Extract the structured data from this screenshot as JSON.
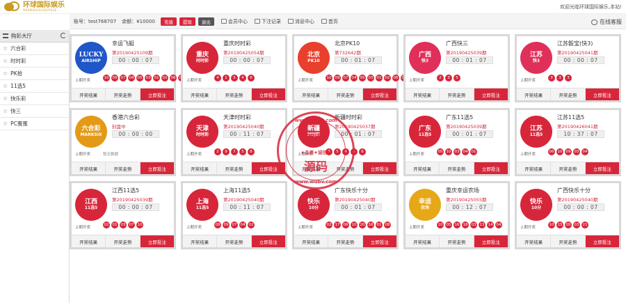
{
  "header": {
    "logo_cn": "环球国际娱乐",
    "logo_en": "HUANQIUGUOJIYULE",
    "welcome": "欢迎光临环球国际娱乐,本站!"
  },
  "account": {
    "account_label": "账号：test768707",
    "balance_label": "余额：¥10000",
    "recharge": "充值",
    "withdraw": "提现",
    "logout": "退出",
    "member_center": "会员中心",
    "bet_records": "下注记录",
    "messages": "消息中心",
    "home": "首页",
    "customer_service": "在线客服"
  },
  "sidebar": {
    "header": "购彩大厅",
    "items": [
      {
        "label": "六合彩"
      },
      {
        "label": "时时彩"
      },
      {
        "label": "PK拾"
      },
      {
        "label": "11选5"
      },
      {
        "label": "快乐彩"
      },
      {
        "label": "快三"
      },
      {
        "label": "PC蛋蛋"
      }
    ]
  },
  "card_labels": {
    "last_draw": "上期开奖",
    "results": "开奖结果",
    "trend": "开奖走势",
    "bet": "立即投注",
    "no_draw": "暂无数据"
  },
  "lotteries": [
    {
      "name": "幸运飞艇",
      "issue": "第20190425109期",
      "timer": "00 : 00 : 07",
      "balls": [
        "10",
        "09",
        "07",
        "04",
        "05",
        "03",
        "01",
        "02",
        "06",
        "08"
      ],
      "badge": {
        "l1": "LUCKY",
        "l2": "AIRSHIP",
        "color": "#1f57c8"
      }
    },
    {
      "name": "重庆时时彩",
      "issue": "第20190425054期",
      "timer": "00 : 00 : 07",
      "balls": [
        "4",
        "1",
        "5",
        "4",
        "6"
      ],
      "badge": {
        "l1": "重庆",
        "l2": "时时彩",
        "color": "#d7263a"
      }
    },
    {
      "name": "北京PK10",
      "issue": "第732642期",
      "timer": "00 : 01 : 07",
      "balls": [
        "10",
        "09",
        "07",
        "04",
        "05",
        "03",
        "01",
        "02",
        "06",
        "08"
      ],
      "badge": {
        "l1": "北京",
        "l2": "PK10",
        "color": "#e8402c"
      }
    },
    {
      "name": "广西快三",
      "issue": "第20190425039期",
      "timer": "00 : 01 : 07",
      "balls": [
        "2",
        "3",
        "5"
      ],
      "badge": {
        "l1": "广西",
        "l2": "快3",
        "color": "#e0305a"
      }
    },
    {
      "name": "江苏骰宝(快3)",
      "issue": "第20190425041期",
      "timer": "00 : 00 : 07",
      "balls": [
        "3",
        "3",
        "3"
      ],
      "badge": {
        "l1": "江苏",
        "l2": "快3",
        "color": "#e0305a"
      }
    },
    {
      "name": "香港六合彩",
      "issue": "封盘中",
      "timer": "00 : 00 : 00",
      "balls": [],
      "badge": {
        "l1": "六合彩",
        "l2": "MARKSIX",
        "color": "#e39a16"
      }
    },
    {
      "name": "天津时时彩",
      "issue": "第20190425040期",
      "timer": "00 : 11 : 07",
      "balls": [
        "2",
        "9",
        "7",
        "5",
        "8"
      ],
      "badge": {
        "l1": "天津",
        "l2": "时时彩",
        "color": "#d7263a"
      }
    },
    {
      "name": "新疆时时彩",
      "issue": "第20190425037期",
      "timer": "00 : 01 : 07",
      "balls": [
        "3",
        "5",
        "4",
        "6",
        "6"
      ],
      "badge": {
        "l1": "新疆",
        "l2": "时时彩",
        "color": "#d7263a"
      }
    },
    {
      "name": "广东11选5",
      "issue": "第20190425039期",
      "timer": "00 : 01 : 07",
      "balls": [
        "05",
        "10",
        "03",
        "04",
        "01"
      ],
      "badge": {
        "l1": "广东",
        "l2": "11选5",
        "color": "#d7263a"
      }
    },
    {
      "name": "江苏11选5",
      "issue": "第20190426041期",
      "timer": "10 : 37 : 07",
      "balls": [
        "06",
        "10",
        "09",
        "03",
        "04"
      ],
      "badge": {
        "l1": "江苏",
        "l2": "11选5",
        "color": "#d7263a"
      }
    },
    {
      "name": "江西11选5",
      "issue": "第20190425039期",
      "timer": "00 : 00 : 07",
      "balls": [
        "02",
        "01",
        "03",
        "07",
        "10"
      ],
      "badge": {
        "l1": "江西",
        "l2": "11选5",
        "color": "#d7263a"
      }
    },
    {
      "name": "上海11选5",
      "issue": "第20190425040期",
      "timer": "00 : 11 : 07",
      "balls": [
        "08",
        "09",
        "07",
        "04",
        "02"
      ],
      "badge": {
        "l1": "上海",
        "l2": "11选5",
        "color": "#d7263a"
      }
    },
    {
      "name": "广东快乐十分",
      "issue": "第20190425040期",
      "timer": "00 : 01 : 07",
      "balls": [
        "02",
        "17",
        "06",
        "10",
        "20",
        "16",
        "01",
        "08"
      ],
      "badge": {
        "l1": "快乐",
        "l2": "10分",
        "color": "#d7263a"
      }
    },
    {
      "name": "重庆幸运农场",
      "issue": "第20190425055期",
      "timer": "00 : 12 : 07",
      "balls": [
        "10",
        "05",
        "16",
        "18",
        "03",
        "13",
        "14",
        "04"
      ],
      "badge": {
        "l1": "幸运",
        "l2": "农场",
        "color": "#e6a817"
      }
    },
    {
      "name": "广西快乐十分",
      "issue": "第20190425040期",
      "timer": "00 : 00 : 07",
      "balls": [
        "10",
        "15",
        "05",
        "03",
        "21"
      ],
      "badge": {
        "l1": "快乐",
        "l2": "10分",
        "color": "#d7263a"
      }
    }
  ],
  "watermark": {
    "top_url": "www.wubv.com",
    "line1": "吾",
    "line2": "爱",
    "slogan": "★品质★诚信★",
    "big": "源码",
    "bottom_url": "www.wubv.com"
  },
  "colors": {
    "accent": "#d7263a",
    "brand_gold": "#c99a1e"
  }
}
